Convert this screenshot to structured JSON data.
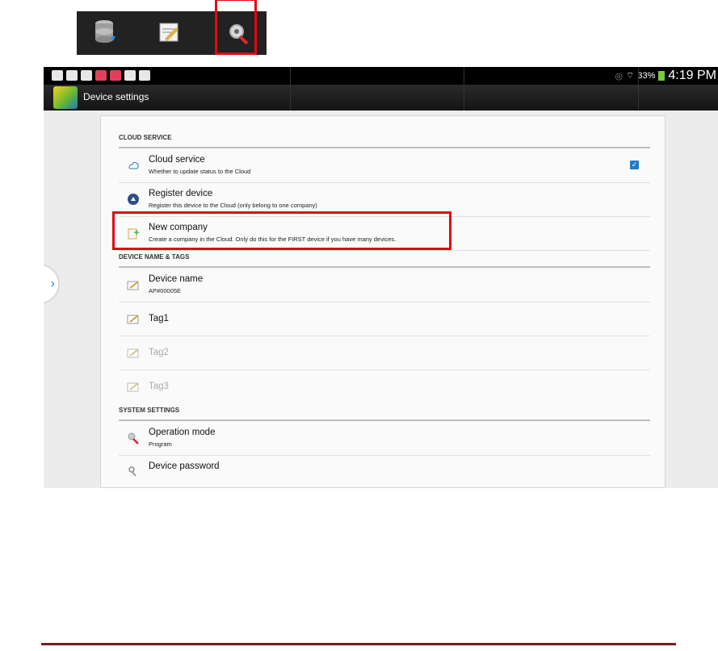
{
  "toolbar": {
    "icons": [
      "database-icon",
      "edit-note-icon",
      "settings-tools-icon"
    ]
  },
  "statusbar": {
    "battery": "33%",
    "time": "4:19 PM"
  },
  "actionbar": {
    "title": "Device settings"
  },
  "sections": {
    "cloud_service": {
      "header": "CLOUD SERVICE",
      "cloud_service": {
        "title": "Cloud service",
        "subtitle": "Whether to update status to the Cloud",
        "checked": true
      },
      "register_device": {
        "title": "Register device",
        "subtitle": "Register this device to the Cloud (only belong to one company)"
      },
      "new_company": {
        "title": "New company",
        "subtitle": "Create a company in the Cloud. Only do this for the FIRST device if you have many devices."
      }
    },
    "device_name_tags": {
      "header": "DEVICE NAME & TAGS",
      "device_name": {
        "title": "Device name",
        "subtitle": "AP#00005E"
      },
      "tag1": {
        "title": "Tag1"
      },
      "tag2": {
        "title": "Tag2"
      },
      "tag3": {
        "title": "Tag3"
      }
    },
    "system_settings": {
      "header": "SYSTEM SETTINGS",
      "operation_mode": {
        "title": "Operation mode",
        "subtitle": "Program"
      },
      "device_password": {
        "title": "Device password"
      }
    }
  },
  "colors": {
    "highlight": "#e30613",
    "accent": "#1f7bc7"
  }
}
